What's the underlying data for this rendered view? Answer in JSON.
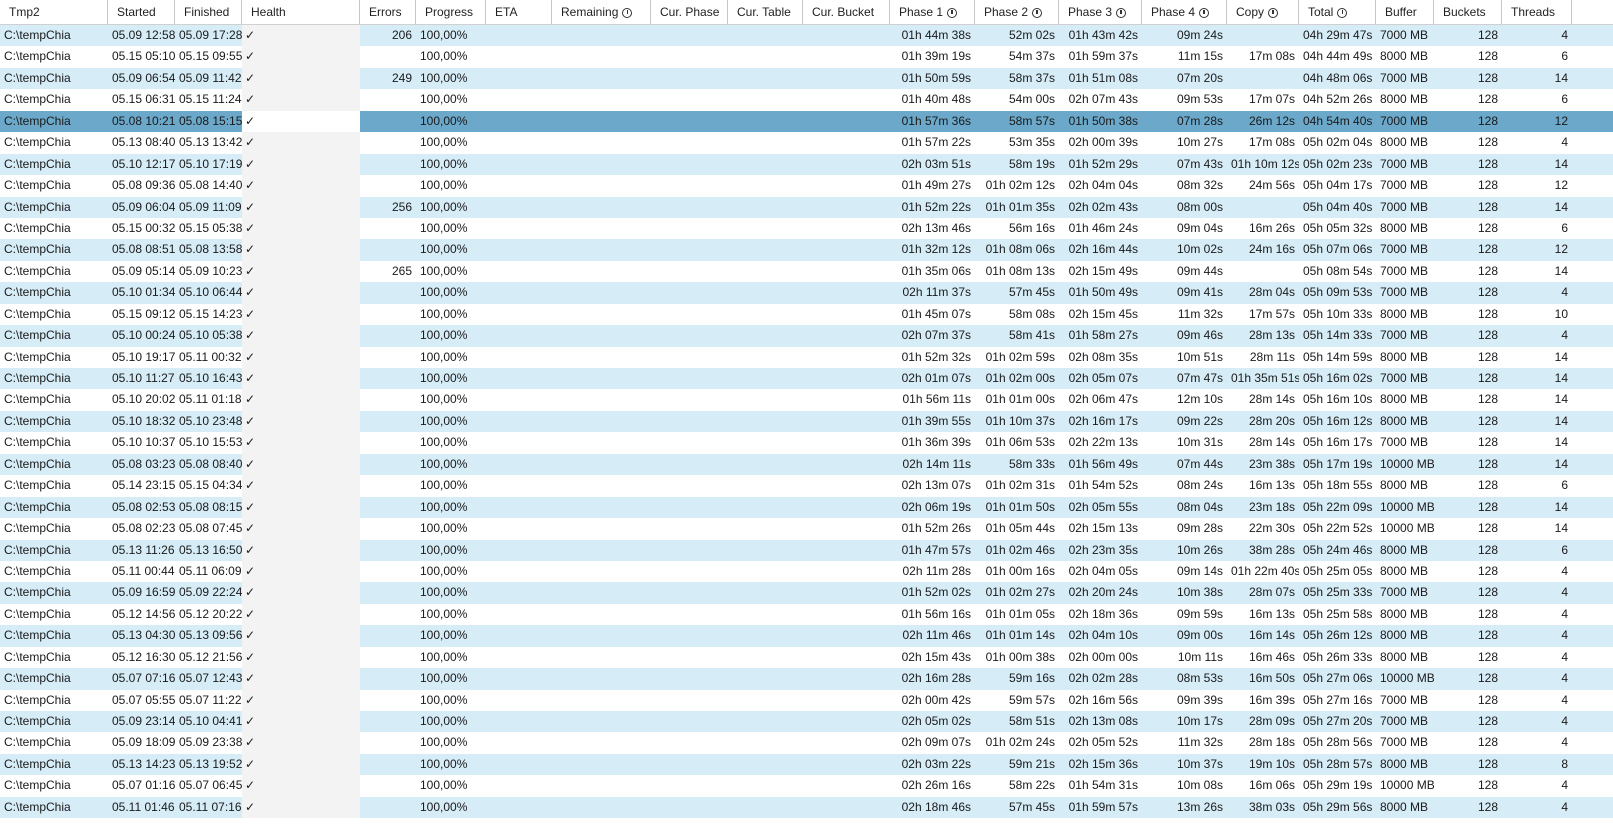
{
  "columns": [
    {
      "label": "Tmp2",
      "clock": false
    },
    {
      "label": "Started",
      "clock": false
    },
    {
      "label": "Finished",
      "clock": false
    },
    {
      "label": "Health",
      "clock": false
    },
    {
      "label": "Errors",
      "clock": false
    },
    {
      "label": "Progress",
      "clock": false
    },
    {
      "label": "ETA",
      "clock": false
    },
    {
      "label": "Remaining",
      "clock": true
    },
    {
      "label": "Cur. Phase",
      "clock": false
    },
    {
      "label": "Cur. Table",
      "clock": false
    },
    {
      "label": "Cur. Bucket",
      "clock": false
    },
    {
      "label": "Phase 1",
      "clock": true
    },
    {
      "label": "Phase 2",
      "clock": true
    },
    {
      "label": "Phase 3",
      "clock": true
    },
    {
      "label": "Phase 4",
      "clock": true
    },
    {
      "label": "Copy",
      "clock": true
    },
    {
      "label": "Total",
      "clock": true
    },
    {
      "label": "Buffer",
      "clock": false
    },
    {
      "label": "Buckets",
      "clock": false
    },
    {
      "label": "Threads",
      "clock": false
    }
  ],
  "health_mark": "✓",
  "selected_row": 4,
  "rows": [
    [
      "C:\\tempChia",
      "05.09 12:58",
      "05.09 17:28",
      "206",
      "100,00%",
      "01h 44m 38s",
      "52m 02s",
      "01h 43m 42s",
      "09m 24s",
      "",
      "04h 29m 47s",
      "7000 MB",
      "128",
      "4"
    ],
    [
      "C:\\tempChia",
      "05.15 05:10",
      "05.15 09:55",
      "",
      "100,00%",
      "01h 39m 19s",
      "54m 37s",
      "01h 59m 37s",
      "11m 15s",
      "17m 08s",
      "04h 44m 49s",
      "8000 MB",
      "128",
      "6"
    ],
    [
      "C:\\tempChia",
      "05.09 06:54",
      "05.09 11:42",
      "249",
      "100,00%",
      "01h 50m 59s",
      "58m 37s",
      "01h 51m 08s",
      "07m 20s",
      "",
      "04h 48m 06s",
      "7000 MB",
      "128",
      "14"
    ],
    [
      "C:\\tempChia",
      "05.15 06:31",
      "05.15 11:24",
      "",
      "100,00%",
      "01h 40m 48s",
      "54m 00s",
      "02h 07m 43s",
      "09m 53s",
      "17m 07s",
      "04h 52m 26s",
      "8000 MB",
      "128",
      "6"
    ],
    [
      "C:\\tempChia",
      "05.08 10:21",
      "05.08 15:15",
      "",
      "100,00%",
      "01h 57m 36s",
      "58m 57s",
      "01h 50m 38s",
      "07m 28s",
      "26m 12s",
      "04h 54m 40s",
      "7000 MB",
      "128",
      "12"
    ],
    [
      "C:\\tempChia",
      "05.13 08:40",
      "05.13 13:42",
      "",
      "100,00%",
      "01h 57m 22s",
      "53m 35s",
      "02h 00m 39s",
      "10m 27s",
      "17m 08s",
      "05h 02m 04s",
      "8000 MB",
      "128",
      "4"
    ],
    [
      "C:\\tempChia",
      "05.10 12:17",
      "05.10 17:19",
      "",
      "100,00%",
      "02h 03m 51s",
      "58m 19s",
      "01h 52m 29s",
      "07m 43s",
      "01h 10m 12s",
      "05h 02m 23s",
      "7000 MB",
      "128",
      "14"
    ],
    [
      "C:\\tempChia",
      "05.08 09:36",
      "05.08 14:40",
      "",
      "100,00%",
      "01h 49m 27s",
      "01h 02m 12s",
      "02h 04m 04s",
      "08m 32s",
      "24m 56s",
      "05h 04m 17s",
      "7000 MB",
      "128",
      "12"
    ],
    [
      "C:\\tempChia",
      "05.09 06:04",
      "05.09 11:09",
      "256",
      "100,00%",
      "01h 52m 22s",
      "01h 01m 35s",
      "02h 02m 43s",
      "08m 00s",
      "",
      "05h 04m 40s",
      "7000 MB",
      "128",
      "14"
    ],
    [
      "C:\\tempChia",
      "05.15 00:32",
      "05.15 05:38",
      "",
      "100,00%",
      "02h 13m 46s",
      "56m 16s",
      "01h 46m 24s",
      "09m 04s",
      "16m 26s",
      "05h 05m 32s",
      "8000 MB",
      "128",
      "6"
    ],
    [
      "C:\\tempChia",
      "05.08 08:51",
      "05.08 13:58",
      "",
      "100,00%",
      "01h 32m 12s",
      "01h 08m 06s",
      "02h 16m 44s",
      "10m 02s",
      "24m 16s",
      "05h 07m 06s",
      "7000 MB",
      "128",
      "12"
    ],
    [
      "C:\\tempChia",
      "05.09 05:14",
      "05.09 10:23",
      "265",
      "100,00%",
      "01h 35m 06s",
      "01h 08m 13s",
      "02h 15m 49s",
      "09m 44s",
      "",
      "05h 08m 54s",
      "7000 MB",
      "128",
      "14"
    ],
    [
      "C:\\tempChia",
      "05.10 01:34",
      "05.10 06:44",
      "",
      "100,00%",
      "02h 11m 37s",
      "57m 45s",
      "01h 50m 49s",
      "09m 41s",
      "28m 04s",
      "05h 09m 53s",
      "7000 MB",
      "128",
      "4"
    ],
    [
      "C:\\tempChia",
      "05.15 09:12",
      "05.15 14:23",
      "",
      "100,00%",
      "01h 45m 07s",
      "58m 08s",
      "02h 15m 45s",
      "11m 32s",
      "17m 57s",
      "05h 10m 33s",
      "8000 MB",
      "128",
      "10"
    ],
    [
      "C:\\tempChia",
      "05.10 00:24",
      "05.10 05:38",
      "",
      "100,00%",
      "02h 07m 37s",
      "58m 41s",
      "01h 58m 27s",
      "09m 46s",
      "28m 13s",
      "05h 14m 33s",
      "7000 MB",
      "128",
      "4"
    ],
    [
      "C:\\tempChia",
      "05.10 19:17",
      "05.11 00:32",
      "",
      "100,00%",
      "01h 52m 32s",
      "01h 02m 59s",
      "02h 08m 35s",
      "10m 51s",
      "28m 11s",
      "05h 14m 59s",
      "8000 MB",
      "128",
      "14"
    ],
    [
      "C:\\tempChia",
      "05.10 11:27",
      "05.10 16:43",
      "",
      "100,00%",
      "02h 01m 07s",
      "01h 02m 00s",
      "02h 05m 07s",
      "07m 47s",
      "01h 35m 51s",
      "05h 16m 02s",
      "7000 MB",
      "128",
      "14"
    ],
    [
      "C:\\tempChia",
      "05.10 20:02",
      "05.11 01:18",
      "",
      "100,00%",
      "01h 56m 11s",
      "01h 01m 00s",
      "02h 06m 47s",
      "12m 10s",
      "28m 14s",
      "05h 16m 10s",
      "8000 MB",
      "128",
      "14"
    ],
    [
      "C:\\tempChia",
      "05.10 18:32",
      "05.10 23:48",
      "",
      "100,00%",
      "01h 39m 55s",
      "01h 10m 37s",
      "02h 16m 17s",
      "09m 22s",
      "28m 20s",
      "05h 16m 12s",
      "8000 MB",
      "128",
      "14"
    ],
    [
      "C:\\tempChia",
      "05.10 10:37",
      "05.10 15:53",
      "",
      "100,00%",
      "01h 36m 39s",
      "01h 06m 53s",
      "02h 22m 13s",
      "10m 31s",
      "28m 14s",
      "05h 16m 17s",
      "7000 MB",
      "128",
      "14"
    ],
    [
      "C:\\tempChia",
      "05.08 03:23",
      "05.08 08:40",
      "",
      "100,00%",
      "02h 14m 11s",
      "58m 33s",
      "01h 56m 49s",
      "07m 44s",
      "23m 38s",
      "05h 17m 19s",
      "10000 MB",
      "128",
      "14"
    ],
    [
      "C:\\tempChia",
      "05.14 23:15",
      "05.15 04:34",
      "",
      "100,00%",
      "02h 13m 07s",
      "01h 02m 31s",
      "01h 54m 52s",
      "08m 24s",
      "16m 13s",
      "05h 18m 55s",
      "8000 MB",
      "128",
      "6"
    ],
    [
      "C:\\tempChia",
      "05.08 02:53",
      "05.08 08:15",
      "",
      "100,00%",
      "02h 06m 19s",
      "01h 01m 50s",
      "02h 05m 55s",
      "08m 04s",
      "23m 18s",
      "05h 22m 09s",
      "10000 MB",
      "128",
      "14"
    ],
    [
      "C:\\tempChia",
      "05.08 02:23",
      "05.08 07:45",
      "",
      "100,00%",
      "01h 52m 26s",
      "01h 05m 44s",
      "02h 15m 13s",
      "09m 28s",
      "22m 30s",
      "05h 22m 52s",
      "10000 MB",
      "128",
      "14"
    ],
    [
      "C:\\tempChia",
      "05.13 11:26",
      "05.13 16:50",
      "",
      "100,00%",
      "01h 47m 57s",
      "01h 02m 46s",
      "02h 23m 35s",
      "10m 26s",
      "38m 28s",
      "05h 24m 46s",
      "8000 MB",
      "128",
      "6"
    ],
    [
      "C:\\tempChia",
      "05.11 00:44",
      "05.11 06:09",
      "",
      "100,00%",
      "02h 11m 28s",
      "01h 00m 16s",
      "02h 04m 05s",
      "09m 14s",
      "01h 22m 40s",
      "05h 25m 05s",
      "8000 MB",
      "128",
      "4"
    ],
    [
      "C:\\tempChia",
      "05.09 16:59",
      "05.09 22:24",
      "",
      "100,00%",
      "01h 52m 02s",
      "01h 02m 27s",
      "02h 20m 24s",
      "10m 38s",
      "28m 07s",
      "05h 25m 33s",
      "7000 MB",
      "128",
      "4"
    ],
    [
      "C:\\tempChia",
      "05.12 14:56",
      "05.12 20:22",
      "",
      "100,00%",
      "01h 56m 16s",
      "01h 01m 05s",
      "02h 18m 36s",
      "09m 59s",
      "16m 13s",
      "05h 25m 58s",
      "8000 MB",
      "128",
      "4"
    ],
    [
      "C:\\tempChia",
      "05.13 04:30",
      "05.13 09:56",
      "",
      "100,00%",
      "02h 11m 46s",
      "01h 01m 14s",
      "02h 04m 10s",
      "09m 00s",
      "16m 14s",
      "05h 26m 12s",
      "8000 MB",
      "128",
      "4"
    ],
    [
      "C:\\tempChia",
      "05.12 16:30",
      "05.12 21:56",
      "",
      "100,00%",
      "02h 15m 43s",
      "01h 00m 38s",
      "02h 00m 00s",
      "10m 11s",
      "16m 46s",
      "05h 26m 33s",
      "8000 MB",
      "128",
      "4"
    ],
    [
      "C:\\tempChia",
      "05.07 07:16",
      "05.07 12:43",
      "",
      "100,00%",
      "02h 16m 28s",
      "59m 16s",
      "02h 02m 28s",
      "08m 53s",
      "16m 50s",
      "05h 27m 06s",
      "10000 MB",
      "128",
      "4"
    ],
    [
      "C:\\tempChia",
      "05.07 05:55",
      "05.07 11:22",
      "",
      "100,00%",
      "02h 00m 42s",
      "59m 57s",
      "02h 16m 56s",
      "09m 39s",
      "16m 39s",
      "05h 27m 16s",
      "7000 MB",
      "128",
      "4"
    ],
    [
      "C:\\tempChia",
      "05.09 23:14",
      "05.10 04:41",
      "",
      "100,00%",
      "02h 05m 02s",
      "58m 51s",
      "02h 13m 08s",
      "10m 17s",
      "28m 09s",
      "05h 27m 20s",
      "7000 MB",
      "128",
      "4"
    ],
    [
      "C:\\tempChia",
      "05.09 18:09",
      "05.09 23:38",
      "",
      "100,00%",
      "02h 09m 07s",
      "01h 02m 24s",
      "02h 05m 52s",
      "11m 32s",
      "28m 18s",
      "05h 28m 56s",
      "7000 MB",
      "128",
      "4"
    ],
    [
      "C:\\tempChia",
      "05.13 14:23",
      "05.13 19:52",
      "",
      "100,00%",
      "02h 03m 22s",
      "59m 21s",
      "02h 15m 36s",
      "10m 37s",
      "19m 10s",
      "05h 28m 57s",
      "8000 MB",
      "128",
      "8"
    ],
    [
      "C:\\tempChia",
      "05.07 01:16",
      "05.07 06:45",
      "",
      "100,00%",
      "02h 26m 16s",
      "58m 22s",
      "01h 54m 31s",
      "10m 08s",
      "16m 06s",
      "05h 29m 19s",
      "10000 MB",
      "128",
      "4"
    ],
    [
      "C:\\tempChia",
      "05.11 01:46",
      "05.11 07:16",
      "",
      "100,00%",
      "02h 18m 46s",
      "57m 45s",
      "01h 59m 57s",
      "13m 26s",
      "38m 03s",
      "05h 29m 56s",
      "8000 MB",
      "128",
      "4"
    ]
  ],
  "colors": {
    "alt_row": "#d6ecf7",
    "selected_row": "#6ba8c9",
    "header_border": "#c6c6c6"
  }
}
